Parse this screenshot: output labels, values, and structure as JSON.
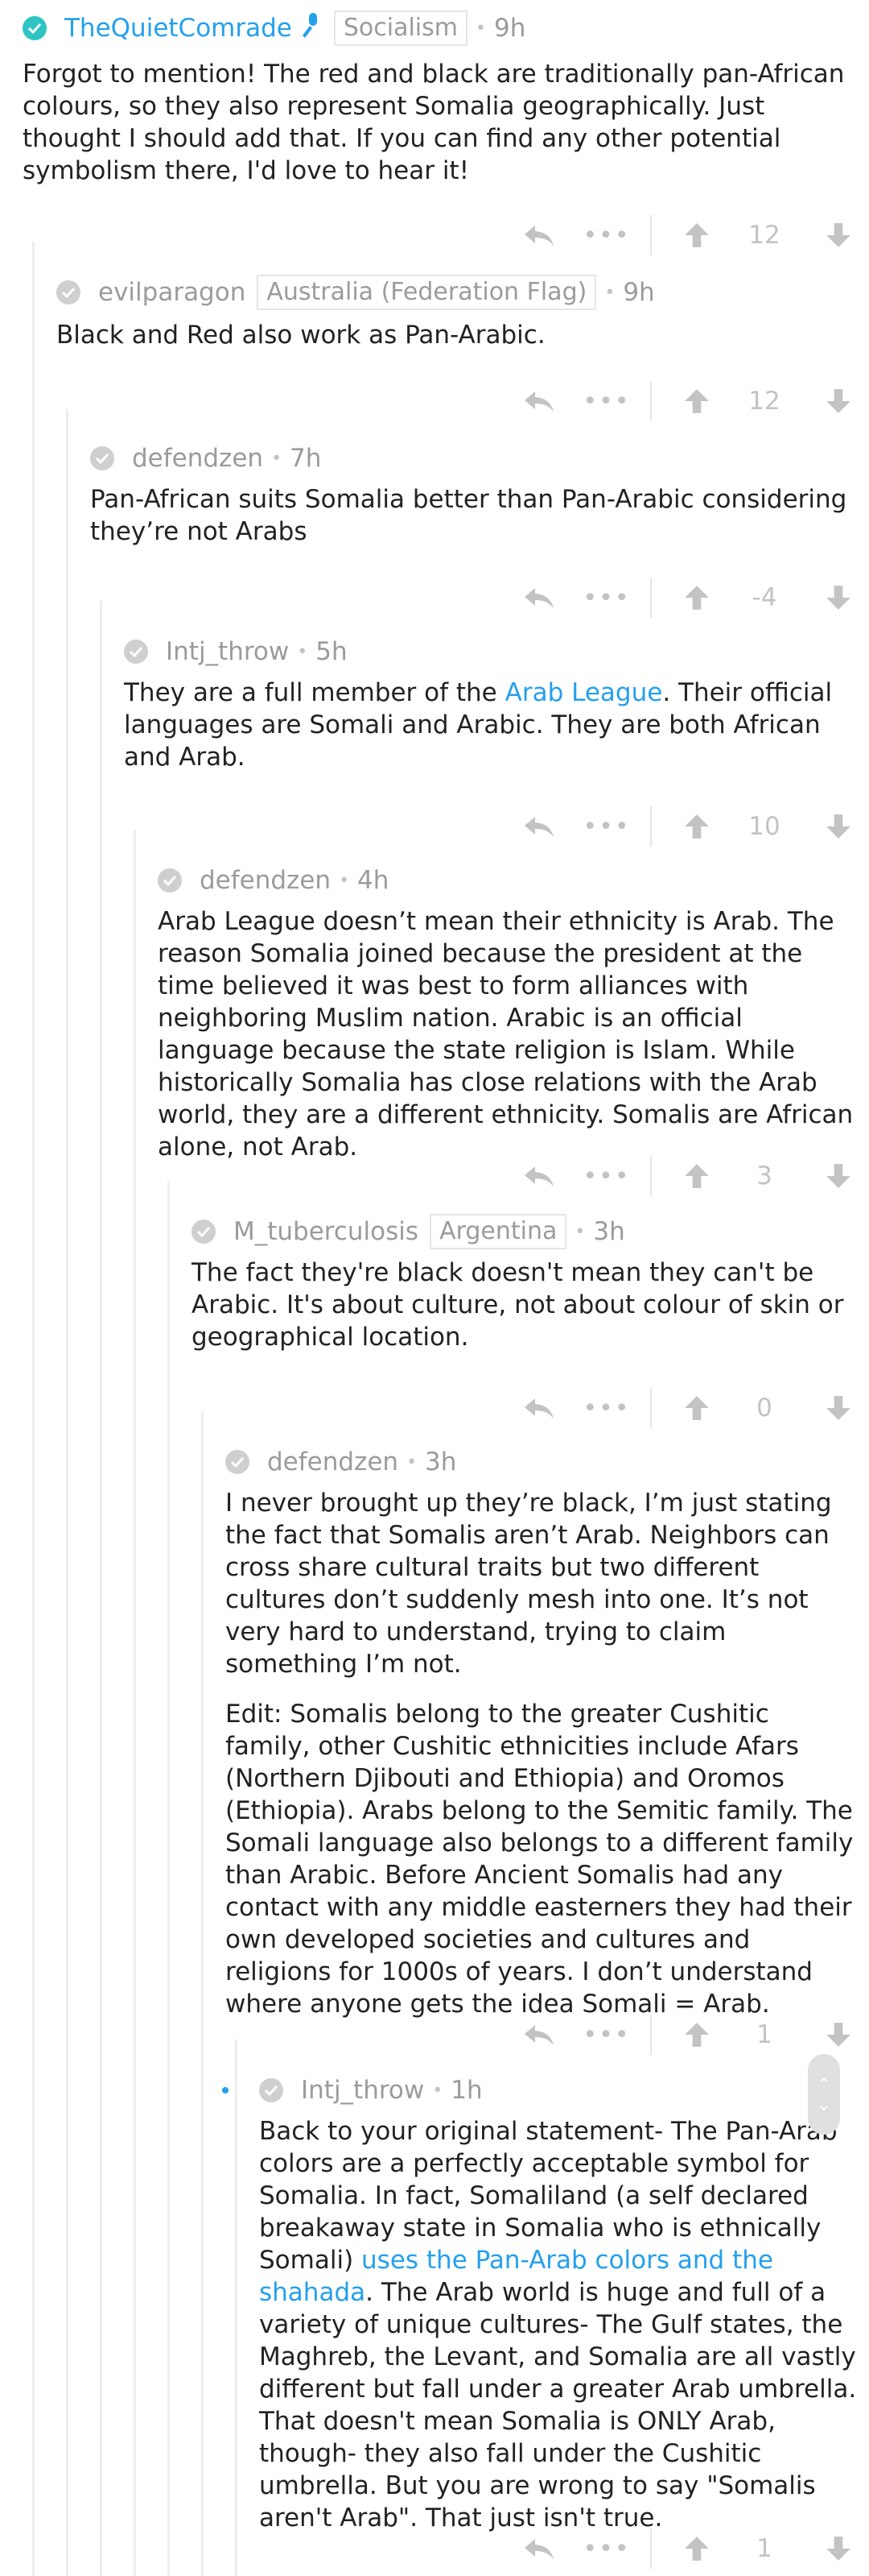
{
  "colors": {
    "accent": "#24a0ed",
    "op_check": "#2ec4c4",
    "muted": "#9b9b9b",
    "icon": "#c3c3c3"
  },
  "comments": [
    {
      "username": "TheQuietComrade",
      "is_op": true,
      "has_mic": true,
      "flair": "Socialism",
      "time": "9h",
      "paragraphs": [
        {
          "parts": [
            {
              "text": "Forgot to mention! The red and black are traditionally pan-African colours, so they also represent Somalia geographically. Just thought I should add that. If you can find any other potential symbolism there, I'd love to hear it!"
            }
          ]
        }
      ],
      "score": "12"
    },
    {
      "username": "evilparagon",
      "flair": "Australia (Federation Flag)",
      "time": "9h",
      "paragraphs": [
        {
          "parts": [
            {
              "text": "Black and Red also work as Pan-Arabic."
            }
          ]
        }
      ],
      "score": "12"
    },
    {
      "username": "defendzen",
      "time": "7h",
      "paragraphs": [
        {
          "parts": [
            {
              "text": "Pan-African suits Somalia better than Pan-Arabic considering they’re not Arabs"
            }
          ]
        }
      ],
      "score": "-4"
    },
    {
      "username": "Intj_throw",
      "time": "5h",
      "paragraphs": [
        {
          "parts": [
            {
              "text": "They are a full member of the "
            },
            {
              "text": "Arab League",
              "link": true
            },
            {
              "text": ". Their official languages are Somali and Arabic. They are both African and Arab."
            }
          ]
        }
      ],
      "score": "10"
    },
    {
      "username": "defendzen",
      "time": "4h",
      "paragraphs": [
        {
          "parts": [
            {
              "text": "Arab League doesn’t mean their ethnicity is Arab. The reason Somalia joined because the president at the time believed it was best to form alliances with neighboring Muslim nation. Arabic is an official language because the state religion is Islam. While historically Somalia has close relations with the Arab world, they are a different ethnicity. Somalis are African alone, not Arab."
            }
          ]
        }
      ],
      "score": "3"
    },
    {
      "username": "M_tuberculosis",
      "flair": "Argentina",
      "time": "3h",
      "paragraphs": [
        {
          "parts": [
            {
              "text": "The fact they're black doesn't mean they can't be Arabic. It's about culture, not about colour of skin or geographical location."
            }
          ]
        }
      ],
      "score": "0"
    },
    {
      "username": "defendzen",
      "time": "3h",
      "paragraphs": [
        {
          "parts": [
            {
              "text": "I never brought up they’re black, I’m just stating the fact that Somalis aren’t Arab. Neighbors can cross share cultural traits but two different cultures don’t suddenly mesh into one. It’s not very hard to understand, trying to claim something I’m not."
            }
          ]
        },
        {
          "parts": [
            {
              "text": "Edit: Somalis belong to the greater Cushitic family, other Cushitic ethnicities include Afars (Northern Djibouti and Ethiopia) and Oromos (Ethiopia). Arabs belong to the Semitic family. The Somali language also belongs to a different family than Arabic. Before Ancient Somalis had any contact with any middle easterners they had their own developed societies and cultures and religions for 1000s of years. I don’t understand where anyone gets the idea Somali = Arab."
            }
          ]
        }
      ],
      "score": "1"
    },
    {
      "username": "Intj_throw",
      "time": "1h",
      "new": true,
      "paragraphs": [
        {
          "parts": [
            {
              "text": "Back to your original statement- The Pan-Arab colors are a perfectly acceptable symbol for Somalia. In fact, Somaliland (a self declared breakaway state in Somalia who is ethnically Somali) "
            },
            {
              "text": "uses the Pan-Arab colors and the shahada",
              "link": true
            },
            {
              "text": ". The Arab world is huge and full of a variety of unique cultures- The Gulf states, the Maghreb, the Levant, and Somalia are all vastly different but fall under a greater Arab umbrella. That doesn't mean Somalia is ONLY Arab, though- they also fall under the Cushitic umbrella. But you are wrong to say \"Somalis aren't Arab\". That just isn't true."
            }
          ]
        }
      ],
      "score": "1"
    }
  ],
  "actions": {
    "more": "•••"
  }
}
